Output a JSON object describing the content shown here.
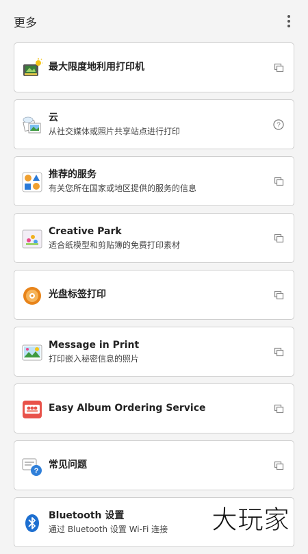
{
  "header": {
    "title": "更多",
    "menu_icon": "more-vertical-icon"
  },
  "items": [
    {
      "title": "最大限度地利用打印机",
      "subtitle": "",
      "icon": "printer-photo-icon",
      "action_icon": "external-link-icon"
    },
    {
      "title": "云",
      "subtitle": "从社交媒体或照片共享站点进行打印",
      "icon": "cloud-photos-icon",
      "action_icon": "help-icon"
    },
    {
      "title": "推荐的服务",
      "subtitle": "有关您所在国家或地区提供的服务的信息",
      "icon": "shapes-icon",
      "action_icon": "external-link-icon"
    },
    {
      "title": "Creative Park",
      "subtitle": "适合纸模型和剪贴簿的免费打印素材",
      "icon": "creative-park-icon",
      "action_icon": "external-link-icon"
    },
    {
      "title": "光盘标签打印",
      "subtitle": "",
      "icon": "disc-icon",
      "action_icon": "external-link-icon"
    },
    {
      "title": "Message in Print",
      "subtitle": "打印嵌入秘密信息的照片",
      "icon": "message-photo-icon",
      "action_icon": "external-link-icon"
    },
    {
      "title": "Easy Album Ordering Service",
      "subtitle": "",
      "icon": "album-icon",
      "action_icon": "external-link-icon"
    },
    {
      "title": "常见问题",
      "subtitle": "",
      "icon": "faq-icon",
      "action_icon": "external-link-icon"
    },
    {
      "title": "Bluetooth 设置",
      "subtitle": "通过 Bluetooth 设置 Wi-Fi 连接",
      "icon": "bluetooth-icon",
      "action_icon": ""
    }
  ],
  "watermark": {
    "text": "大玩家"
  },
  "colors": {
    "background": "#f4f4f4",
    "card": "#ffffff",
    "border": "#cfcfcf",
    "icon_gray": "#888888",
    "album_red": "#e8524a",
    "disc_orange": "#e8841a",
    "bluetooth_blue": "#1d6fd0",
    "faq_blue": "#2f7fd9"
  }
}
